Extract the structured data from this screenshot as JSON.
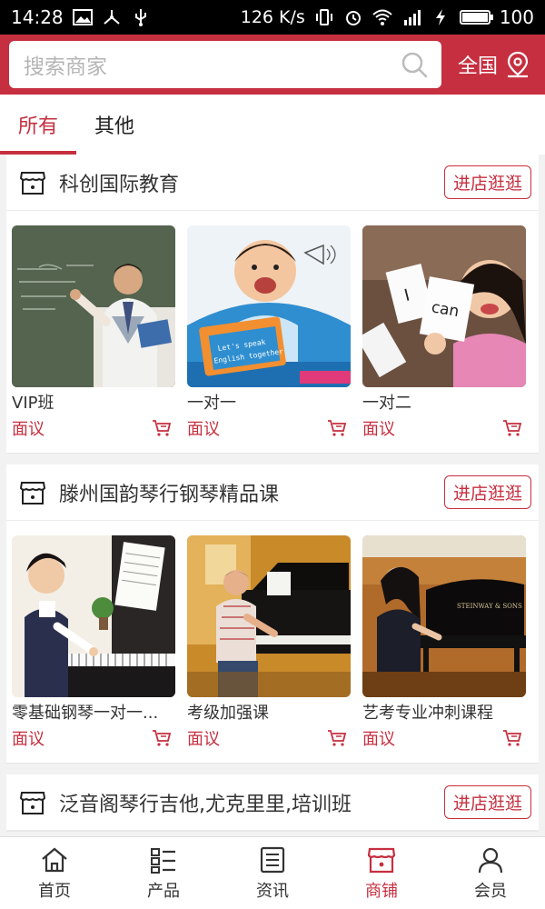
{
  "status_bar": {
    "time": "14:28",
    "speed": "126 K/s",
    "battery": "100",
    "battery_level": 1.0,
    "network": "4G"
  },
  "search": {
    "placeholder": "搜索商家"
  },
  "region": {
    "label": "全国"
  },
  "tabs": [
    {
      "label": "所有",
      "active": true
    },
    {
      "label": "其他",
      "active": false
    }
  ],
  "stores": [
    {
      "name": "科创国际教育",
      "visit_label": "进店逛逛",
      "products": [
        {
          "name": "VIP班",
          "price": "面议"
        },
        {
          "name": "一对一",
          "price": "面议"
        },
        {
          "name": "一对二",
          "price": "面议"
        }
      ]
    },
    {
      "name": "滕州国韵琴行钢琴精品课",
      "visit_label": "进店逛逛",
      "products": [
        {
          "name": "零基础钢琴一对一...",
          "price": "面议"
        },
        {
          "name": "考级加强课",
          "price": "面议"
        },
        {
          "name": "艺考专业冲刺课程",
          "price": "面议"
        }
      ]
    },
    {
      "name": "泛音阁琴行吉他,尤克里里,培训班",
      "visit_label": "进店逛逛",
      "products": []
    }
  ],
  "image_text": {
    "card_line1": "Let's speak",
    "card_line2": "English together",
    "flash_card_1": "I",
    "flash_card_2": "can",
    "piano_brand": "STEINWAY & SONS"
  },
  "bottom_nav": [
    {
      "label": "首页",
      "icon": "home-icon",
      "active": false
    },
    {
      "label": "产品",
      "icon": "list-icon",
      "active": false
    },
    {
      "label": "资讯",
      "icon": "news-icon",
      "active": false
    },
    {
      "label": "商铺",
      "icon": "shop-icon",
      "active": true
    },
    {
      "label": "会员",
      "icon": "user-icon",
      "active": false
    }
  ],
  "colors": {
    "brand": "#c62f3f",
    "bg": "#f2f2f2"
  }
}
